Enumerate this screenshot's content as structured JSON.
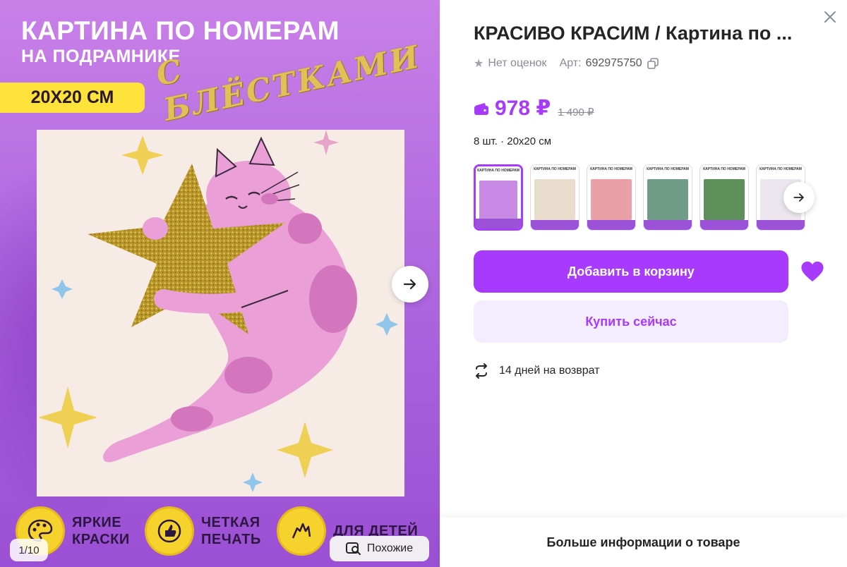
{
  "banner": {
    "title": "КАРТИНА ПО НОМЕРАМ",
    "subtitle": "НА ПОДРАМНИКЕ",
    "size": "20Х20 СМ",
    "glitter": "С БЛЁСТКАМИ"
  },
  "features": [
    {
      "line1": "ЯРКИЕ",
      "line2": "КРАСКИ"
    },
    {
      "line1": "ЧЕТКАЯ",
      "line2": "ПЕЧАТЬ"
    },
    {
      "line1": "ДЛЯ ДЕТЕЙ",
      "line2": ""
    }
  ],
  "gallery": {
    "counter": "1/10",
    "similar_label": "Похожие"
  },
  "product": {
    "title": "КРАСИВО КРАСИМ / Картина по ...",
    "rating_text": "Нет оценок",
    "art_label": "Арт:",
    "art_number": "692975750",
    "price": "978 ₽",
    "old_price": "1 490 ₽",
    "variant": "8 шт. · 20х20 см",
    "thumbnails": [
      {
        "header": "КАРТИНА ПО НОМЕРАМ",
        "selected": true,
        "color": "#c98ae6"
      },
      {
        "header": "КАРТИНА ПО НОМЕРАМ",
        "selected": false,
        "color": "#e8dccd"
      },
      {
        "header": "КАРТИНА ПО НОМЕРАМ",
        "selected": false,
        "color": "#e9a0a6"
      },
      {
        "header": "КАРТИНА ПО НОМЕРАМ",
        "selected": false,
        "color": "#6f9c86"
      },
      {
        "header": "КАРТИНА ПО НОМЕРАМ",
        "selected": false,
        "color": "#5d8f5a"
      },
      {
        "header": "КАРТИНА ПО НОМЕРАМ",
        "selected": false,
        "color": "#ece7ee"
      }
    ],
    "add_to_cart": "Добавить в корзину",
    "buy_now": "Купить сейчас",
    "returns": "14 дней на возврат",
    "more_info": "Больше информации о товаре"
  },
  "colors": {
    "accent": "#a73afd",
    "accent_light": "#f4ecff",
    "banner_yellow": "#ffe23a"
  }
}
